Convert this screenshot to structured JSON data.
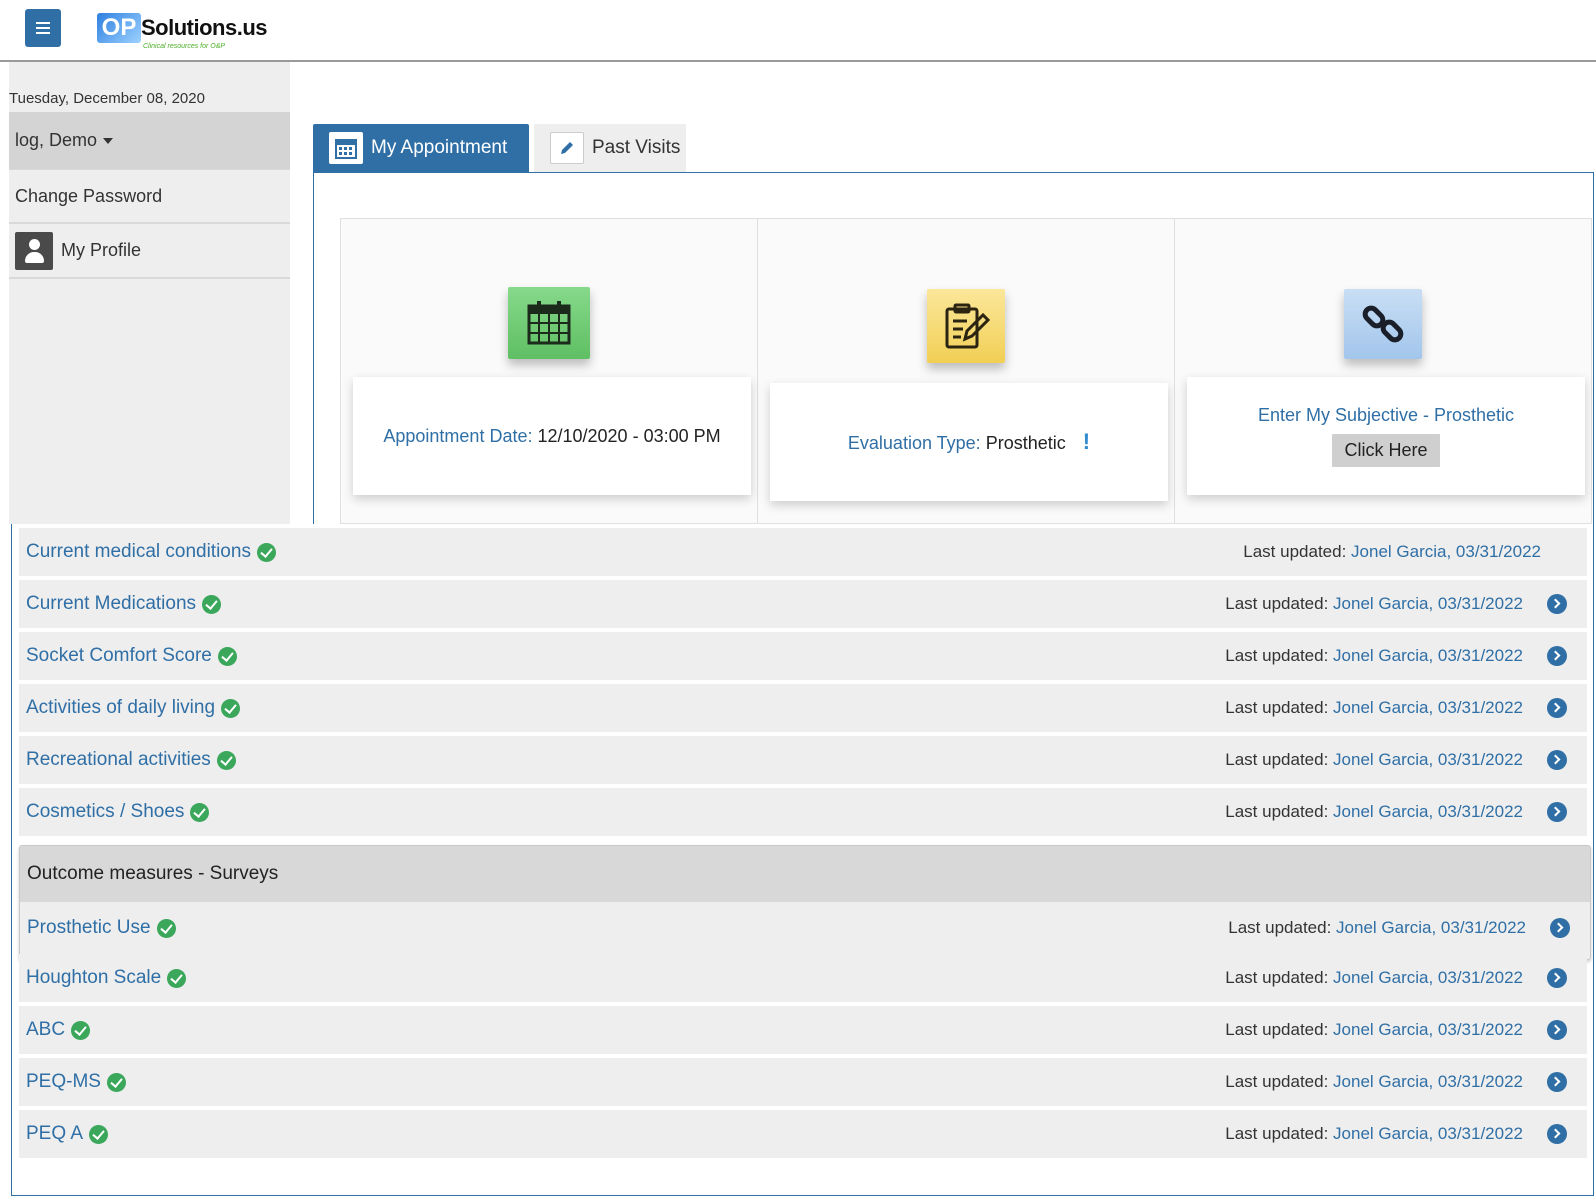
{
  "header": {
    "logo_mark": "OP",
    "logo_name": "Solutions.us",
    "logo_tagline": "Clinical resources for O&P"
  },
  "sidebar": {
    "date": "Tuesday, December 08, 2020",
    "user_menu": "log, Demo",
    "items": [
      {
        "label": "Change Password"
      },
      {
        "label": "My Profile"
      }
    ]
  },
  "tabs": [
    {
      "label": "My Appointment",
      "active": true
    },
    {
      "label": "Past Visits",
      "active": false
    }
  ],
  "cards": {
    "appointment": {
      "label": "Appointment Date:",
      "value": "12/10/2020 - 03:00 PM"
    },
    "evaluation": {
      "label": "Evaluation Type:",
      "value": "Prosthetic",
      "info": "!"
    },
    "subjective": {
      "label": "Enter My Subjective - Prosthetic",
      "button": "Click Here"
    }
  },
  "list": {
    "updated_prefix": "Last updated:",
    "rows": [
      {
        "title": "Current medical conditions",
        "updated_by": "Jonel Garcia, 03/31/2022"
      },
      {
        "title": "Current Medications",
        "updated_by": "Jonel Garcia, 03/31/2022"
      },
      {
        "title": "Socket Comfort Score",
        "updated_by": "Jonel Garcia, 03/31/2022"
      },
      {
        "title": "Activities of daily living",
        "updated_by": "Jonel Garcia, 03/31/2022"
      },
      {
        "title": "Recreational activities",
        "updated_by": "Jonel Garcia, 03/31/2022"
      },
      {
        "title": "Cosmetics / Shoes",
        "updated_by": "Jonel Garcia, 03/31/2022"
      }
    ],
    "group": {
      "title": "Outcome measures - Surveys",
      "rows": [
        {
          "title": "Prosthetic Use",
          "updated_by": "Jonel Garcia, 03/31/2022"
        }
      ]
    },
    "rows_after": [
      {
        "title": "Houghton Scale",
        "updated_by": "Jonel Garcia, 03/31/2022"
      },
      {
        "title": "ABC",
        "updated_by": "Jonel Garcia, 03/31/2022"
      },
      {
        "title": "PEQ-MS",
        "updated_by": "Jonel Garcia, 03/31/2022"
      },
      {
        "title": "PEQ A",
        "updated_by": "Jonel Garcia, 03/31/2022"
      }
    ]
  },
  "colors": {
    "primary": "#2f6fa6",
    "check": "#3aa75b",
    "row_bg": "#eeeeee"
  }
}
